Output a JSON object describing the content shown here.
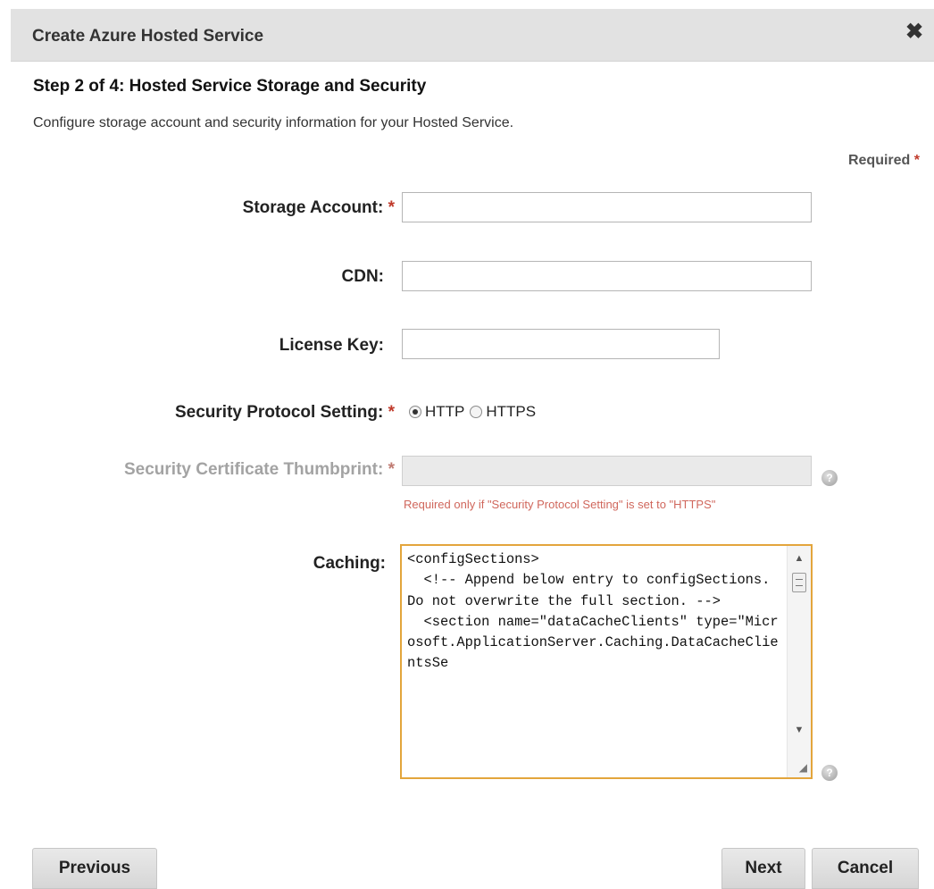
{
  "dialog": {
    "title": "Create Azure Hosted Service",
    "close_symbol": "✖",
    "step_title": "Step 2 of 4: Hosted Service Storage and Security",
    "step_description": "Configure storage account and security information for your Hosted Service.",
    "required_label": "Required",
    "required_star": "*"
  },
  "form": {
    "storage_account": {
      "label": "Storage Account:",
      "value": ""
    },
    "cdn": {
      "label": "CDN:",
      "value": ""
    },
    "license_key": {
      "label": "License Key:",
      "value": ""
    },
    "security_protocol": {
      "label": "Security Protocol Setting:",
      "options": [
        "HTTP",
        "HTTPS"
      ],
      "selected": "HTTP"
    },
    "security_thumbprint": {
      "label": "Security Certificate Thumbprint:",
      "value": "",
      "hint": "Required only if \"Security Protocol Setting\" is set to \"HTTPS\"",
      "disabled": true
    },
    "caching": {
      "label": "Caching:",
      "value": "<configSections>\n  <!-- Append below entry to configSections. Do not overwrite the full section. -->\n  <section name=\"dataCacheClients\" type=\"Microsoft.ApplicationServer.Caching.DataCacheClientsSe"
    },
    "help_symbol": "?"
  },
  "buttons": {
    "previous": "Previous",
    "next": "Next",
    "cancel": "Cancel"
  },
  "colors": {
    "required_star": "#c03a2b",
    "hint_text": "#d0675c",
    "focus_border": "#e3a53c",
    "titlebar_bg": "#e2e2e2"
  },
  "icons": {
    "close": "close-icon",
    "help": "help-icon",
    "scroll_up": "scroll-up-icon",
    "scroll_down": "scroll-down-icon",
    "resize": "resize-grip-icon"
  }
}
